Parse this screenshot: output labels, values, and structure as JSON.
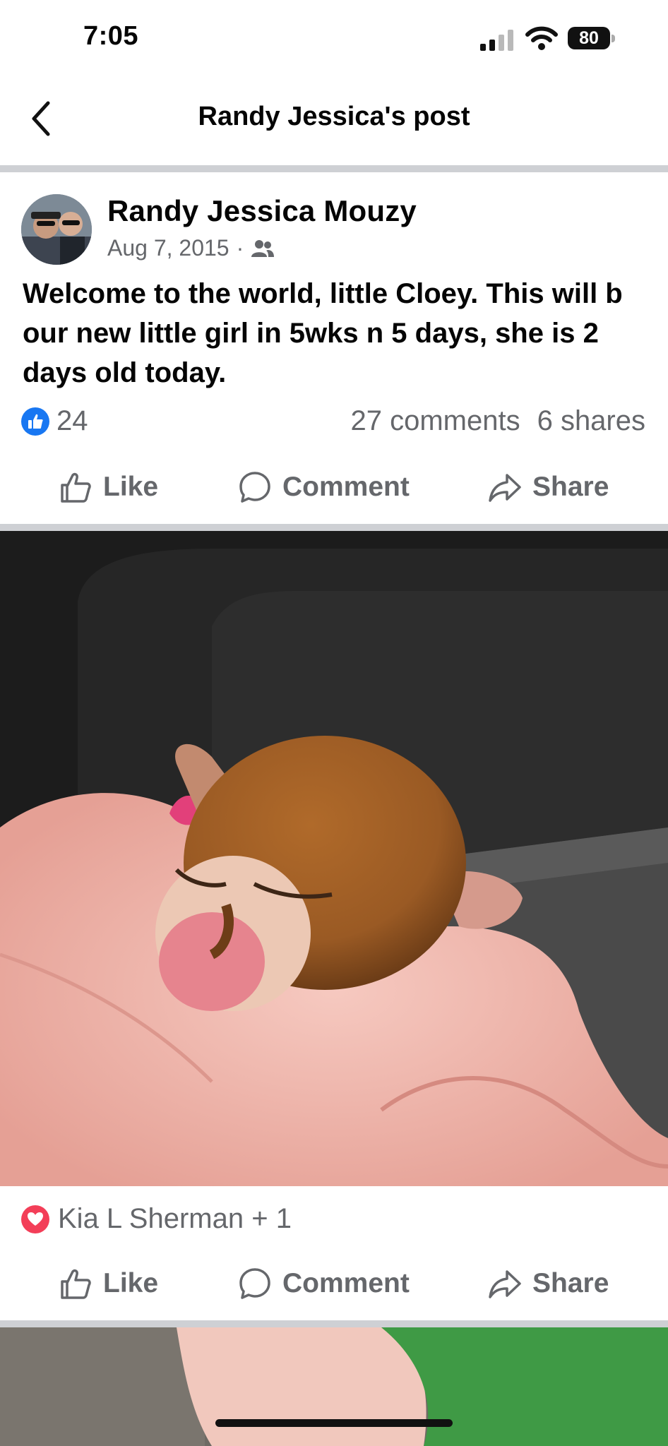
{
  "status_bar": {
    "time": "7:05",
    "battery": "80"
  },
  "header": {
    "title": "Randy Jessica's post"
  },
  "post": {
    "author": "Randy Jessica Mouzy",
    "date": "Aug 7, 2015",
    "separator": "·",
    "text": "Welcome to the world, little Cloey. This will b our new  little girl in 5wks n 5 days, she is 2 days old today.",
    "like_count": "24",
    "comments": "27 comments",
    "shares": "6 shares"
  },
  "actions": {
    "like": "Like",
    "comment": "Comment",
    "share": "Share"
  },
  "photo": {
    "reactors": "Kia L Sherman + 1"
  },
  "colors": {
    "like_blue": "#1877f2",
    "love_red": "#f33e58",
    "secondary_text": "#65676b",
    "divider": "#ced0d4"
  }
}
